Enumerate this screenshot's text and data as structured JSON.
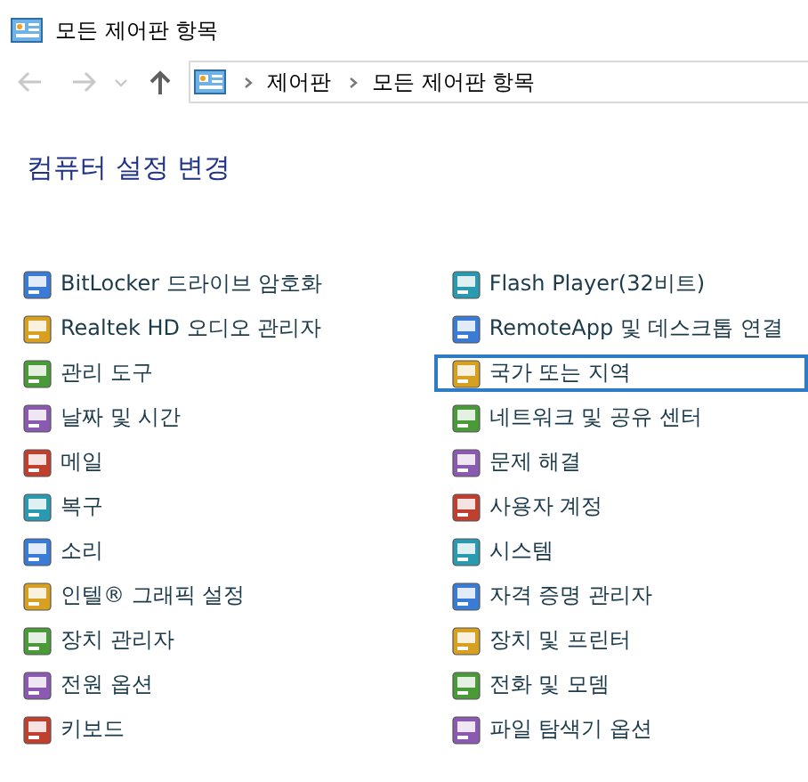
{
  "window": {
    "title": "모든 제어판 항목"
  },
  "address_bar": {
    "path": [
      "제어판",
      "모든 제어판 항목"
    ]
  },
  "heading": "컴퓨터 설정 변경",
  "columns": [
    {
      "items": [
        {
          "label": "BitLocker 드라이브 암호화",
          "selected": false
        },
        {
          "label": "Realtek HD 오디오 관리자",
          "selected": false
        },
        {
          "label": "관리 도구",
          "selected": false
        },
        {
          "label": "날짜 및 시간",
          "selected": false
        },
        {
          "label": "메일",
          "selected": false
        },
        {
          "label": "복구",
          "selected": false
        },
        {
          "label": "소리",
          "selected": false
        },
        {
          "label": "인텔® 그래픽 설정",
          "selected": false
        },
        {
          "label": "장치 관리자",
          "selected": false
        },
        {
          "label": "전원 옵션",
          "selected": false
        },
        {
          "label": "키보드",
          "selected": false
        }
      ]
    },
    {
      "items": [
        {
          "label": "Flash Player(32비트)",
          "selected": false
        },
        {
          "label": "RemoteApp 및 데스크톱 연결",
          "selected": false
        },
        {
          "label": "국가 또는 지역",
          "selected": true
        },
        {
          "label": "네트워크 및 공유 센터",
          "selected": false
        },
        {
          "label": "문제 해결",
          "selected": false
        },
        {
          "label": "사용자 계정",
          "selected": false
        },
        {
          "label": "시스템",
          "selected": false
        },
        {
          "label": "자격 증명 관리자",
          "selected": false
        },
        {
          "label": "장치 및 프린터",
          "selected": false
        },
        {
          "label": "전화 및 모뎀",
          "selected": false
        },
        {
          "label": "파일 탐색기 옵션",
          "selected": false
        }
      ]
    }
  ]
}
